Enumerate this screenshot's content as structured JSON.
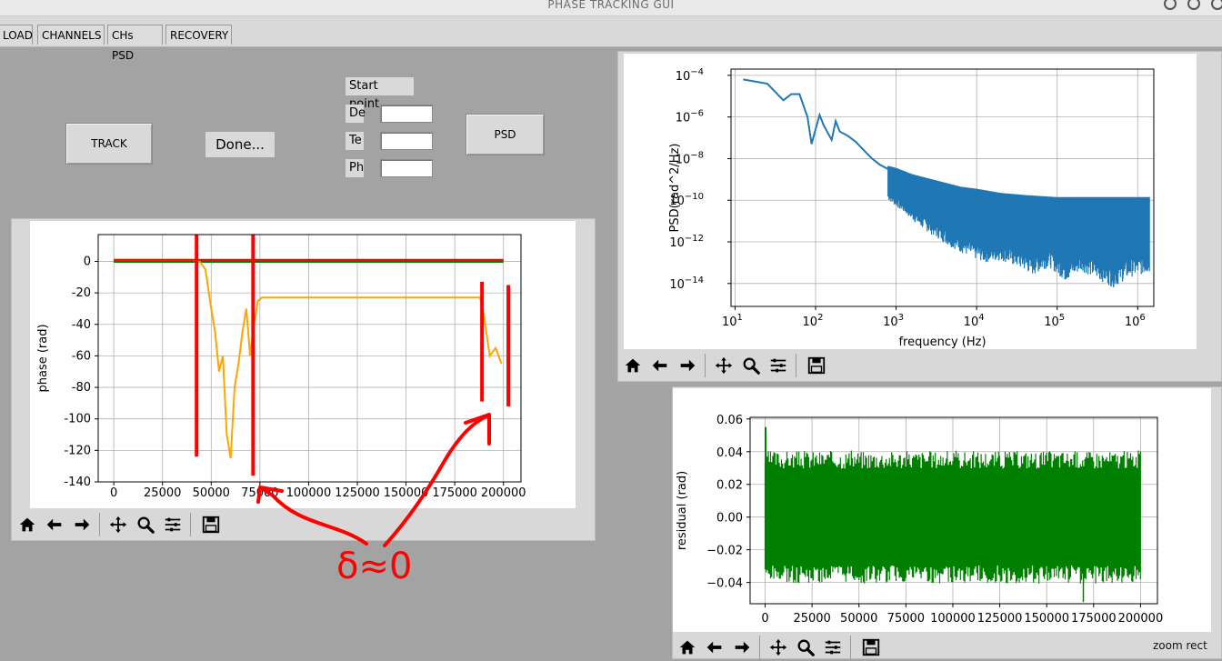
{
  "window": {
    "title": "PHASE TRACKING GUI"
  },
  "tabs": [
    "LOAD",
    "CHANNELS",
    "CHs PSD",
    "RECOVERY"
  ],
  "controls": {
    "track_label": "TRACK",
    "done_label": "Done...",
    "psd_label": "PSD",
    "start_point_label": "Start point",
    "fields": [
      {
        "label": "De",
        "value": ""
      },
      {
        "label": "Te",
        "value": ""
      },
      {
        "label": "Ph",
        "value": ""
      }
    ]
  },
  "annotation": {
    "text": "δ≈0",
    "color": "#ff0000"
  },
  "status": {
    "zoom": "zoom rect"
  },
  "colors": {
    "psd": "#1f77b4",
    "residual": "#008000",
    "orange": "#ffa500",
    "red_marks": "#ff0000",
    "green": "#008000"
  },
  "icons": [
    "home-icon",
    "back-arrow-icon",
    "forward-arrow-icon",
    "pan-icon",
    "zoom-icon",
    "configure-subplots-icon",
    "save-icon"
  ],
  "chart_data": [
    {
      "id": "phase",
      "type": "line",
      "ylabel": "phase (rad)",
      "xlabel": "",
      "xlim": [
        -8000,
        209000
      ],
      "ylim": [
        -140,
        17
      ],
      "xticks": [
        0,
        25000,
        50000,
        75000,
        100000,
        125000,
        150000,
        175000,
        200000
      ],
      "yticks": [
        0,
        -20,
        -40,
        -60,
        -80,
        -100,
        -120,
        -140
      ],
      "series": [
        {
          "color": "#008000",
          "x": [
            0,
            200000
          ],
          "y": [
            0,
            0
          ]
        },
        {
          "color": "#ffa500",
          "x": [
            0,
            40000,
            44000,
            47000,
            50000,
            52000,
            54000,
            56000,
            58000,
            60000,
            62000,
            64000,
            66000,
            68000,
            70000,
            72000,
            74000,
            76000,
            80000,
            120000,
            160000,
            188000,
            190000,
            193000,
            196000,
            199000
          ],
          "y": [
            1,
            1,
            0,
            -5,
            -30,
            -45,
            -70,
            -60,
            -110,
            -125,
            -80,
            -65,
            -45,
            -30,
            -60,
            -40,
            -25,
            -23,
            -23,
            -23,
            -23,
            -23,
            -35,
            -60,
            -55,
            -65
          ]
        },
        {
          "color": "#ff0000",
          "x": [
            0,
            40000,
            80000,
            120000,
            160000,
            200000
          ],
          "y": [
            1,
            1,
            1,
            1,
            1,
            1
          ]
        }
      ],
      "red_bars": [
        {
          "x": 42500,
          "y1": 17,
          "y2": -124
        },
        {
          "x": 71500,
          "y1": 17,
          "y2": -136
        },
        {
          "x": 189000,
          "y1": -13,
          "y2": -89
        },
        {
          "x": 202500,
          "y1": -15,
          "y2": -92
        }
      ]
    },
    {
      "id": "psd",
      "type": "line",
      "xlabel": "frequency (Hz)",
      "ylabel": "PSD(rad^2/Hz)",
      "xscale": "log",
      "yscale": "log",
      "xlim_exp": [
        0.95,
        6.2
      ],
      "ylim_exp": [
        -15.1,
        -3.7
      ],
      "xtick_exps": [
        1,
        2,
        3,
        4,
        5,
        6
      ],
      "ytick_exps": [
        -4,
        -6,
        -8,
        -10,
        -12,
        -14
      ],
      "series": [
        {
          "color": "#1f77b4",
          "x_exp": [
            1.1,
            1.4,
            1.6,
            1.7,
            1.8,
            1.9,
            1.95,
            2.0,
            2.05,
            2.1,
            2.2,
            2.25,
            2.3,
            2.4,
            2.5,
            2.6,
            2.7,
            2.8,
            2.9,
            3.0,
            3.2,
            3.4,
            3.6,
            3.8,
            4.0,
            4.3,
            4.6,
            5.0,
            5.4,
            5.8,
            6.15
          ],
          "y_exp": [
            -4.2,
            -4.4,
            -5.2,
            -4.9,
            -4.9,
            -6.0,
            -7.3,
            -6.6,
            -5.9,
            -6.4,
            -7.1,
            -6.2,
            -6.7,
            -6.9,
            -7.2,
            -7.6,
            -8.0,
            -8.3,
            -8.5,
            -8.6,
            -8.9,
            -9.1,
            -9.3,
            -9.5,
            -9.6,
            -9.8,
            -9.9,
            -10.0,
            -10.0,
            -10.0,
            -10.0
          ]
        },
        {
          "color": "#1f77b4",
          "x_exp": [
            2.9,
            3.1,
            3.3,
            3.5,
            3.7,
            3.9,
            4.1,
            4.3,
            4.5,
            4.7,
            4.9,
            5.1,
            5.3,
            5.5,
            5.7,
            5.9,
            6.15
          ],
          "y_exp": [
            -10.0,
            -10.6,
            -11.3,
            -11.8,
            -12.3,
            -12.7,
            -13.0,
            -12.9,
            -13.2,
            -13.6,
            -13.2,
            -13.9,
            -13.4,
            -13.8,
            -14.2,
            -13.7,
            -13.5
          ]
        }
      ]
    },
    {
      "id": "residual",
      "type": "line",
      "ylabel": "residual (rad)",
      "xlabel": "",
      "xlim": [
        -8000,
        209000
      ],
      "ylim": [
        -0.053,
        0.061
      ],
      "xticks": [
        0,
        25000,
        50000,
        75000,
        100000,
        125000,
        150000,
        175000,
        200000
      ],
      "yticks": [
        0.06,
        0.04,
        0.02,
        0.0,
        -0.02,
        -0.04
      ],
      "series": [
        {
          "color": "#008000",
          "band_upper": 0.037,
          "band_lower": -0.037,
          "peak_high": 0.055,
          "peak_low": -0.052
        }
      ]
    }
  ]
}
